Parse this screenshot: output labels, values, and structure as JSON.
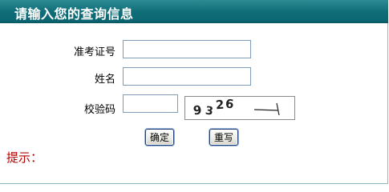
{
  "header": {
    "title": "请输入您的查询信息"
  },
  "form": {
    "exam_id_label": "准考证号",
    "exam_id_value": "",
    "name_label": "姓名",
    "name_value": "",
    "captcha_label": "校验码",
    "captcha_value": "",
    "captcha_image_text": "9326"
  },
  "buttons": {
    "confirm": "确定",
    "reset": "重写"
  },
  "hint": {
    "label": "提示："
  },
  "colors": {
    "header": "#0f6d78",
    "hint": "#b30000",
    "field_border": "#7f9db9"
  }
}
